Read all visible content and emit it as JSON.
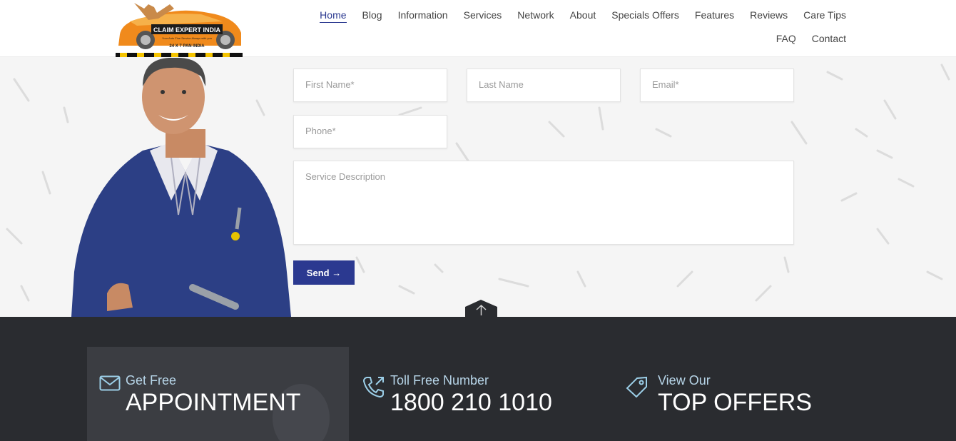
{
  "header": {
    "logo": {
      "title": "CLAIM EXPERT INDIA",
      "tagline": "Your Auto Fine Service Always with you",
      "sub": "24 X 7 PAN INDIA"
    },
    "nav": [
      {
        "label": "Home",
        "active": true
      },
      {
        "label": "Blog"
      },
      {
        "label": "Information"
      },
      {
        "label": "Services"
      },
      {
        "label": "Network"
      },
      {
        "label": "About"
      },
      {
        "label": "Specials Offers"
      },
      {
        "label": "Features"
      },
      {
        "label": "Reviews"
      },
      {
        "label": "Care Tips"
      },
      {
        "label": "FAQ"
      },
      {
        "label": "Contact"
      }
    ]
  },
  "form": {
    "first_name": "First Name*",
    "last_name": "Last Name",
    "email": "Email*",
    "phone": "Phone*",
    "description": "Service Description",
    "send": "Send →"
  },
  "footer": {
    "appointment": {
      "small": "Get Free",
      "big": "APPOINTMENT"
    },
    "toll": {
      "small": "Toll Free Number",
      "big": "1800 210 1010"
    },
    "offers": {
      "small": "View Our",
      "big": "TOP OFFERS"
    }
  },
  "colors": {
    "accent": "#2b3990",
    "footer_bg": "#2a2c30",
    "icon_blue": "#9ccfe8"
  }
}
